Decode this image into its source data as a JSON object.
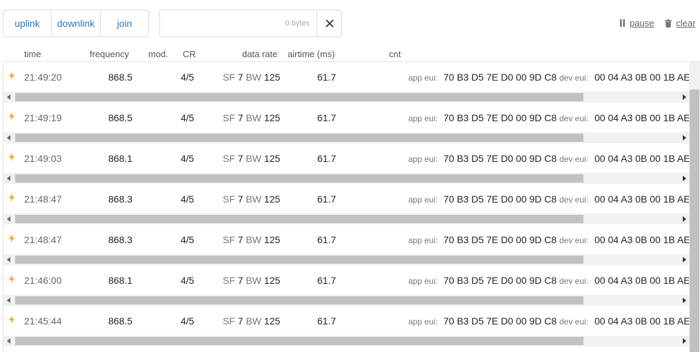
{
  "filters": {
    "uplink": "uplink",
    "downlink": "downlink",
    "join": "join"
  },
  "search": {
    "value": "",
    "bytes": "0 bytes"
  },
  "actions": {
    "pause": "pause",
    "clear": "clear"
  },
  "columns": {
    "time": "time",
    "frequency": "frequency",
    "mod": "mod.",
    "cr": "CR",
    "data_rate": "data rate",
    "airtime": "airtime (ms)",
    "cnt": "cnt"
  },
  "labels": {
    "sf": "SF",
    "bw": "BW",
    "app_eui": "app eui:",
    "dev_eui": "dev eui:"
  },
  "colors": {
    "accent": "#2a7ab8",
    "uplink_bolt": "#f5a623"
  },
  "messages": [
    {
      "time": "21:49:20",
      "frequency": "868.5",
      "cr": "4/5",
      "sf": "7",
      "bw": "125",
      "airtime": "61.7",
      "app_eui": "70 B3 D5 7E D0 00 9D C8",
      "dev_eui": "00 04 A3 0B 00 1B AE"
    },
    {
      "time": "21:49:19",
      "frequency": "868.5",
      "cr": "4/5",
      "sf": "7",
      "bw": "125",
      "airtime": "61.7",
      "app_eui": "70 B3 D5 7E D0 00 9D C8",
      "dev_eui": "00 04 A3 0B 00 1B AE"
    },
    {
      "time": "21:49:03",
      "frequency": "868.1",
      "cr": "4/5",
      "sf": "7",
      "bw": "125",
      "airtime": "61.7",
      "app_eui": "70 B3 D5 7E D0 00 9D C8",
      "dev_eui": "00 04 A3 0B 00 1B AE"
    },
    {
      "time": "21:48:47",
      "frequency": "868.3",
      "cr": "4/5",
      "sf": "7",
      "bw": "125",
      "airtime": "61.7",
      "app_eui": "70 B3 D5 7E D0 00 9D C8",
      "dev_eui": "00 04 A3 0B 00 1B AE"
    },
    {
      "time": "21:48:47",
      "frequency": "868.3",
      "cr": "4/5",
      "sf": "7",
      "bw": "125",
      "airtime": "61.7",
      "app_eui": "70 B3 D5 7E D0 00 9D C8",
      "dev_eui": "00 04 A3 0B 00 1B AE"
    },
    {
      "time": "21:46:00",
      "frequency": "868.1",
      "cr": "4/5",
      "sf": "7",
      "bw": "125",
      "airtime": "61.7",
      "app_eui": "70 B3 D5 7E D0 00 9D C8",
      "dev_eui": "00 04 A3 0B 00 1B AE"
    },
    {
      "time": "21:45:44",
      "frequency": "868.5",
      "cr": "4/5",
      "sf": "7",
      "bw": "125",
      "airtime": "61.7",
      "app_eui": "70 B3 D5 7E D0 00 9D C8",
      "dev_eui": "00 04 A3 0B 00 1B AE"
    }
  ]
}
